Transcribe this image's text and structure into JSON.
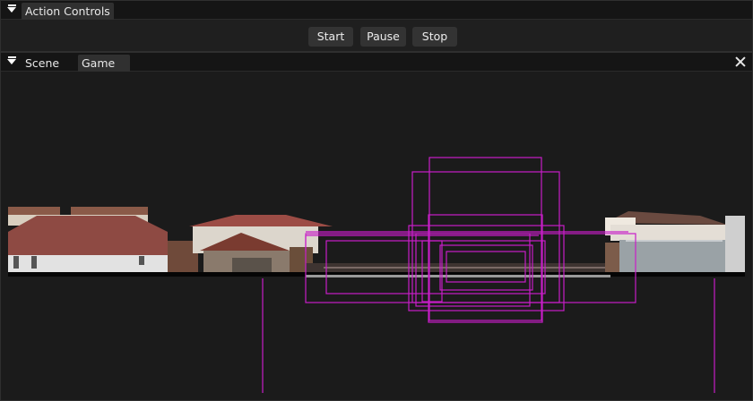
{
  "controls": {
    "title": "Action Controls",
    "start_label": "Start",
    "pause_label": "Pause",
    "stop_label": "Stop"
  },
  "viewport": {
    "tabs": [
      {
        "label": "Scene",
        "active": false
      },
      {
        "label": "Game",
        "active": true
      }
    ]
  },
  "colors": {
    "debug_outline": "#c81ec8",
    "background": "#1b1b1b"
  }
}
